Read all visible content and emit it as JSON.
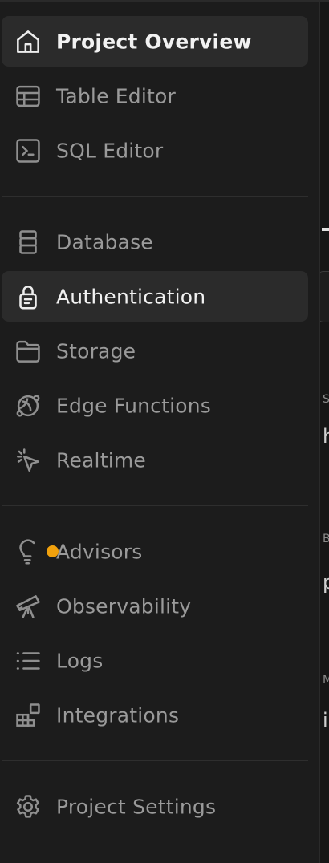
{
  "sidebar": {
    "groups": [
      [
        {
          "label": "Project Overview",
          "icon": "home-icon",
          "active": true
        },
        {
          "label": "Table Editor",
          "icon": "table-icon",
          "active": false
        },
        {
          "label": "SQL Editor",
          "icon": "terminal-icon",
          "active": false
        }
      ],
      [
        {
          "label": "Database",
          "icon": "database-icon",
          "active": false
        },
        {
          "label": "Authentication",
          "icon": "lock-icon",
          "active": true
        },
        {
          "label": "Storage",
          "icon": "folder-icon",
          "active": false
        },
        {
          "label": "Edge Functions",
          "icon": "edge-functions-icon",
          "active": false
        },
        {
          "label": "Realtime",
          "icon": "realtime-cursor-icon",
          "active": false
        }
      ],
      [
        {
          "label": "Advisors",
          "icon": "lightbulb-icon",
          "active": false,
          "badge_color": "#f1a10d"
        },
        {
          "label": "Observability",
          "icon": "telescope-icon",
          "active": false
        },
        {
          "label": "Logs",
          "icon": "list-icon",
          "active": false
        },
        {
          "label": "Integrations",
          "icon": "integrations-icon",
          "active": false
        }
      ],
      [
        {
          "label": "Project Settings",
          "icon": "gear-icon",
          "active": false
        }
      ]
    ]
  },
  "right_pane": {
    "fragments": [
      "h",
      "p",
      "i"
    ],
    "small_fragments": [
      "S",
      "B",
      "M"
    ]
  },
  "colors": {
    "sidebar_bg": "#1c1c1c",
    "active_bg": "#2b2b2b",
    "text_muted": "#9a9a9a",
    "text_active": "#f2f2f2",
    "badge": "#f1a10d"
  }
}
